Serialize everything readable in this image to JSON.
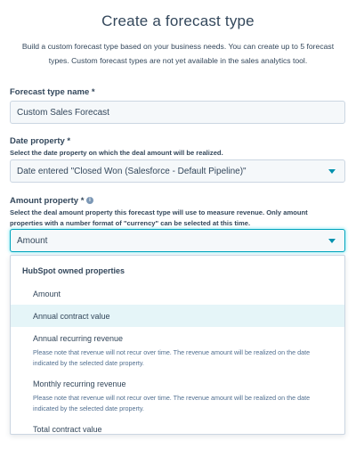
{
  "page": {
    "title": "Create a forecast type",
    "intro": "Build a custom forecast type based on your business needs. You can create up to 5 forecast types. Custom forecast types are not yet available in the sales analytics tool."
  },
  "forecast_name": {
    "label": "Forecast type name *",
    "value": "Custom Sales Forecast"
  },
  "date_property": {
    "label": "Date property *",
    "help": "Select the date property on which the deal amount will be realized.",
    "value": "Date entered \"Closed Won (Salesforce - Default Pipeline)\""
  },
  "amount_property": {
    "label": "Amount property *",
    "info_icon": "info-icon",
    "help": "Select the deal amount property this forecast type will use to measure revenue. Only amount properties with a number format of \"currency\" can be selected at this time.",
    "value": "Amount"
  },
  "dropdown": {
    "group_label": "HubSpot owned properties",
    "options": [
      {
        "label": "Amount",
        "desc": ""
      },
      {
        "label": "Annual contract value",
        "desc": "",
        "highlighted": true
      },
      {
        "label": "Annual recurring revenue",
        "desc": "Please note that revenue will not recur over time. The revenue amount will be realized on the date indicated by the selected date property."
      },
      {
        "label": "Monthly recurring revenue",
        "desc": "Please note that revenue will not recur over time. The revenue amount will be realized on the date indicated by the selected date property."
      },
      {
        "label": "Total contract value",
        "desc": ""
      }
    ]
  },
  "colors": {
    "accent": "#0091ae",
    "highlight": "#e5f5f8",
    "text": "#33475b",
    "field_bg": "#f5f8fa",
    "border": "#cbd6e2"
  }
}
